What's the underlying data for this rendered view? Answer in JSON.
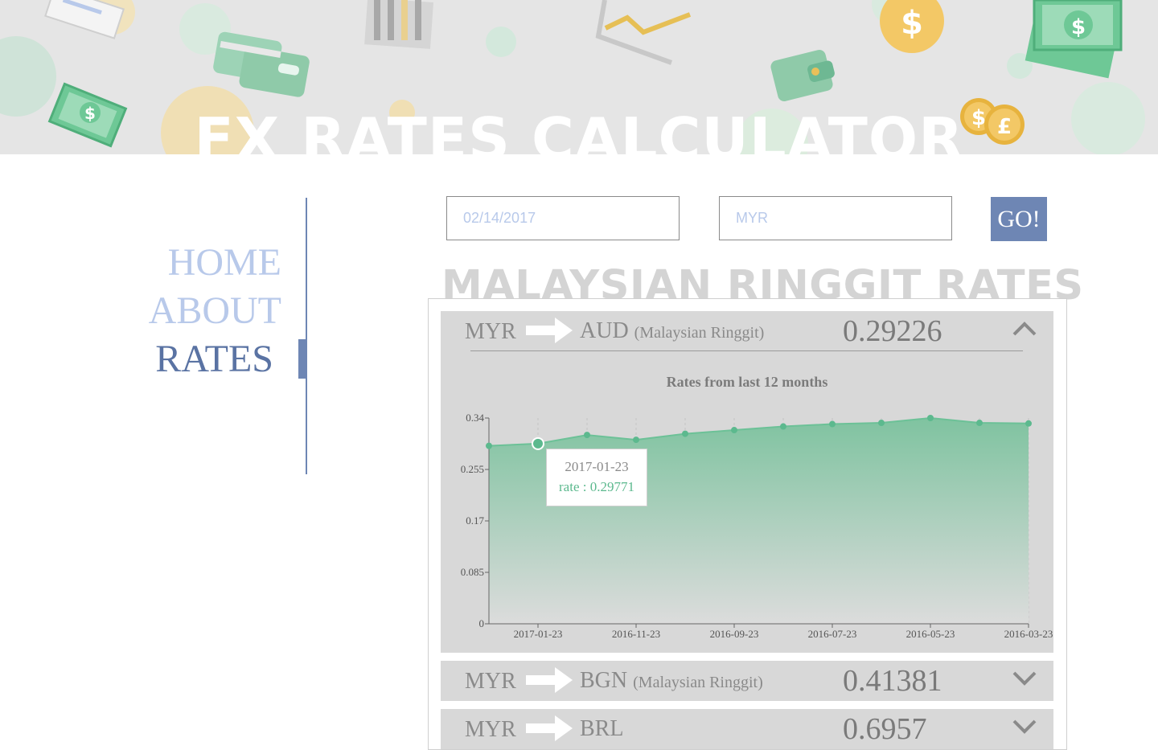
{
  "header": {
    "title": "FX RATES CALCULATOR"
  },
  "nav": {
    "items": [
      {
        "label": "HOME",
        "active": false
      },
      {
        "label": "ABOUT",
        "active": false
      },
      {
        "label": "RATES",
        "active": true
      }
    ]
  },
  "form": {
    "date_value": "02/14/2017",
    "currency_value": "MYR",
    "go_label": "GO!"
  },
  "section_title": "MALAYSIAN RINGGIT RATES",
  "rates": [
    {
      "from": "MYR",
      "to": "AUD",
      "name": "(Malaysian Ringgit)",
      "rate": "0.29226",
      "expanded": true
    },
    {
      "from": "MYR",
      "to": "BGN",
      "name": "(Malaysian Ringgit)",
      "rate": "0.41381",
      "expanded": false
    },
    {
      "from": "MYR",
      "to": "BRL",
      "name": "",
      "rate": "0.6957",
      "expanded": false
    }
  ],
  "tooltip": {
    "date": "2017-01-23",
    "rate_label": "rate : 0.29771"
  },
  "colors": {
    "accent": "#6e86b4",
    "chart_green": "#5cb98e",
    "panel_bg": "#d8d8d8"
  },
  "chart_data": {
    "type": "area",
    "title": "Rates from last 12 months",
    "xlabel": "",
    "ylabel": "",
    "ylim": [
      0,
      0.34
    ],
    "yticks": [
      "0",
      "0.085",
      "0.17",
      "0.255",
      "0.34"
    ],
    "x": [
      "2017-02-23",
      "2017-01-23",
      "2016-12-23",
      "2016-11-23",
      "2016-10-23",
      "2016-09-23",
      "2016-08-23",
      "2016-07-23",
      "2016-06-23",
      "2016-05-23",
      "2016-04-23",
      "2016-03-23"
    ],
    "xticks": [
      "2017-01-23",
      "2016-11-23",
      "2016-09-23",
      "2016-07-23",
      "2016-05-23",
      "2016-03-23"
    ],
    "values": [
      0.294,
      0.29771,
      0.312,
      0.304,
      0.314,
      0.32,
      0.326,
      0.33,
      0.332,
      0.34,
      0.332,
      0.331
    ],
    "grid": true,
    "highlight_index": 1
  }
}
